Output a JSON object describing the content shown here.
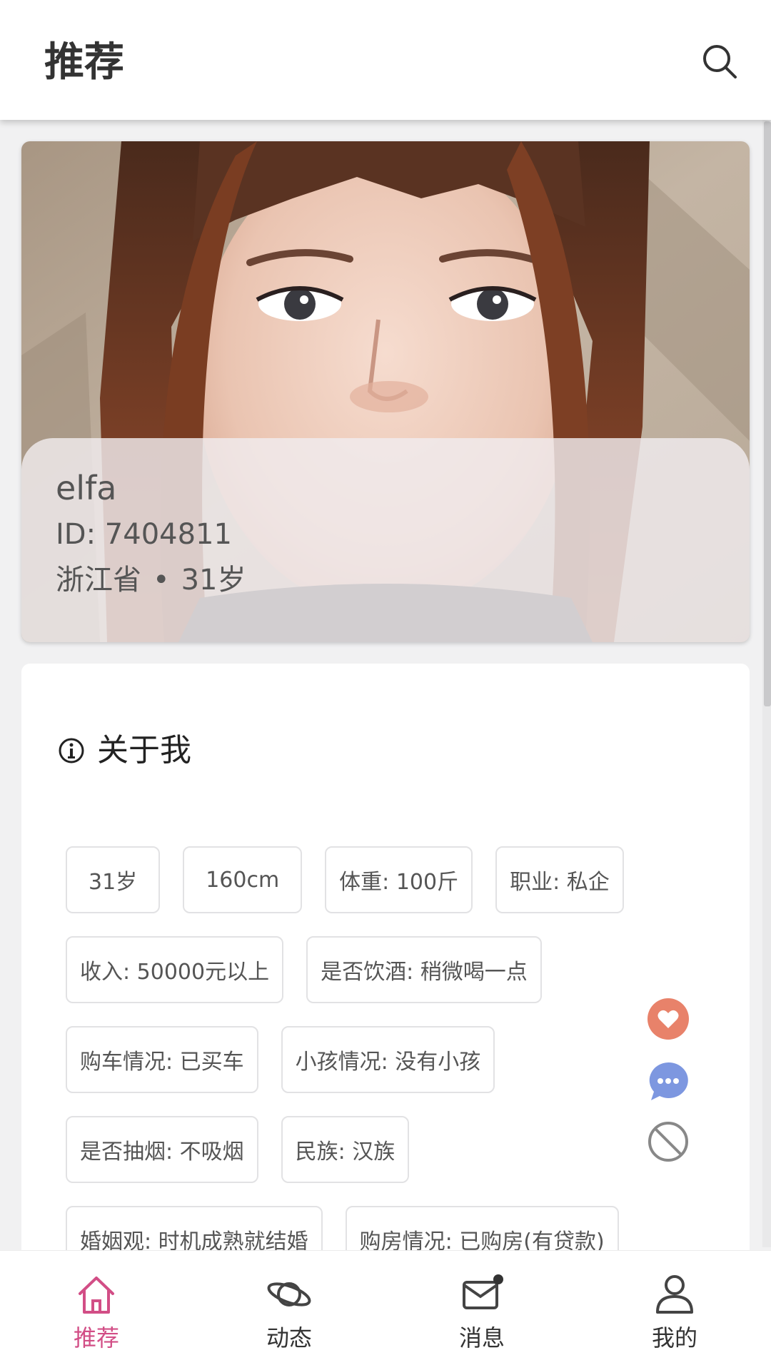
{
  "header": {
    "title": "推荐",
    "search_icon": "search-icon"
  },
  "profile": {
    "nickname": "elfa",
    "id_text": "ID: 7404811",
    "province": "浙江省",
    "separator": "•",
    "age": "31岁"
  },
  "about": {
    "title": "关于我",
    "icon": "info-icon",
    "tags": [
      "31岁",
      "160cm",
      "体重: 100斤",
      "职业: 私企",
      "收入: 50000元以上",
      "是否饮酒: 稍微喝一点",
      "购车情况: 已买车",
      "小孩情况: 没有小孩",
      "是否抽烟: 不吸烟",
      "民族: 汉族",
      "婚姻观: 时机成熟就结婚",
      "购房情况: 已购房(有贷款)"
    ]
  },
  "actions": {
    "like_icon": "heart-icon",
    "chat_icon": "chat-bubble-icon",
    "block_icon": "block-icon",
    "like_color": "#e8826a",
    "chat_color": "#7d97e0",
    "block_color": "#888888"
  },
  "nav": {
    "active_color": "#d24e86",
    "items": [
      {
        "label": "推荐",
        "icon": "home-icon"
      },
      {
        "label": "动态",
        "icon": "planet-icon"
      },
      {
        "label": "消息",
        "icon": "mail-icon"
      },
      {
        "label": "我的",
        "icon": "person-icon"
      }
    ]
  }
}
